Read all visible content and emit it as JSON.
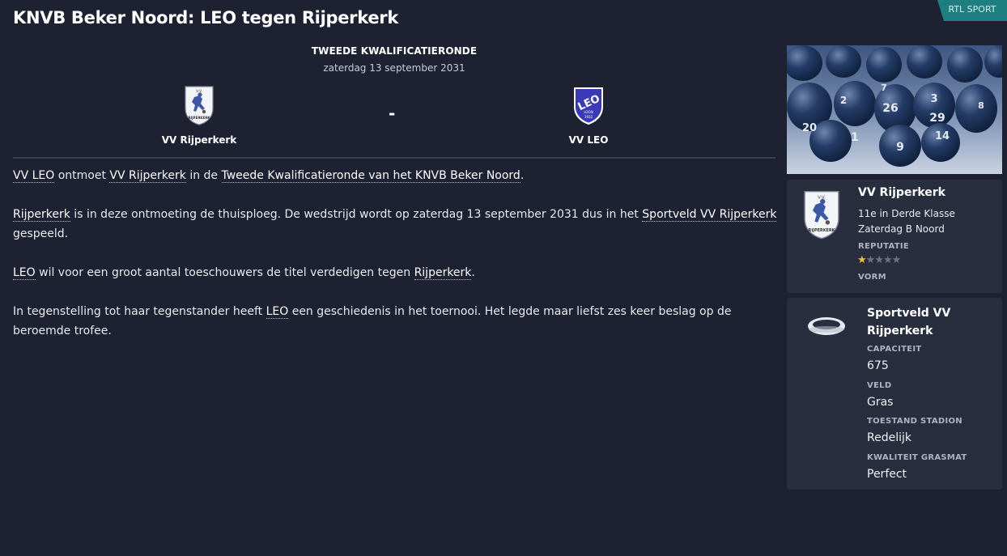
{
  "header": {
    "title": "KNVB Beker Noord: LEO tegen Rijperkerk",
    "source_badge": "RTL SPORT"
  },
  "match": {
    "round": "TWEEDE KWALIFICATIERONDE",
    "date": "zaterdag 13 september 2031",
    "home_team": "VV Rijperkerk",
    "away_team": "VV LEO",
    "separator": "-"
  },
  "article": {
    "p1": {
      "link_leo": "VV LEO",
      "t1": " ontmoet ",
      "link_rijperkerk": "VV Rijperkerk",
      "t2": " in de ",
      "link_round": "Tweede Kwalificatieronde van het KNVB Beker Noord",
      "t3": "."
    },
    "p2": {
      "link_rijperkerk": "Rijperkerk",
      "t1": " is in deze ontmoeting de thuisploeg. De wedstrijd wordt op zaterdag 13 september 2031 dus in het ",
      "link_stadium": "Sportveld VV Rijperkerk",
      "t2": " gespeeld."
    },
    "p3": {
      "link_leo": "LEO",
      "t1": " wil voor een groot aantal toeschouwers de titel verdedigen tegen ",
      "link_rijperkerk": "Rijperkerk",
      "t2": "."
    },
    "p4": {
      "t1": "In tegenstelling tot haar tegenstander heeft ",
      "link_leo": "LEO",
      "t2": " een geschiedenis in het toernooi. Het legde maar liefst zes keer beslag op de beroemde trofee."
    }
  },
  "club_card": {
    "name": "VV Rijperkerk",
    "position": "11e in Derde Klasse Zaterdag B Noord",
    "reputation_label": "REPUTATIE",
    "reputation_stars": 0.5,
    "reputation_max": 5,
    "form_label": "VORM"
  },
  "stadium_card": {
    "name": "Sportveld VV Rijperkerk",
    "capacity_label": "CAPACITEIT",
    "capacity": "675",
    "pitch_label": "VELD",
    "pitch": "Gras",
    "condition_label": "TOESTAND STADION",
    "condition": "Redelijk",
    "turf_label": "KWALITEIT GRASMAT",
    "turf": "Perfect"
  },
  "image": {
    "ball_numbers": [
      "2",
      "7",
      "26",
      "3",
      "29",
      "20",
      "1",
      "9",
      "14",
      "8"
    ]
  },
  "crests": {
    "home_text_top": "V.V.",
    "home_text_bottom": "RIJPERKERK",
    "away_text": "LEO",
    "away_town": "LOON",
    "away_year": "1932"
  },
  "colors": {
    "background": "#1d2131",
    "card": "#292e3f",
    "badge": "#1f7f80",
    "star": "#f2c230",
    "leo_blue": "#3a3ab8"
  },
  "icons": {
    "stadium": "stadium-icon",
    "star": "star-icon"
  }
}
